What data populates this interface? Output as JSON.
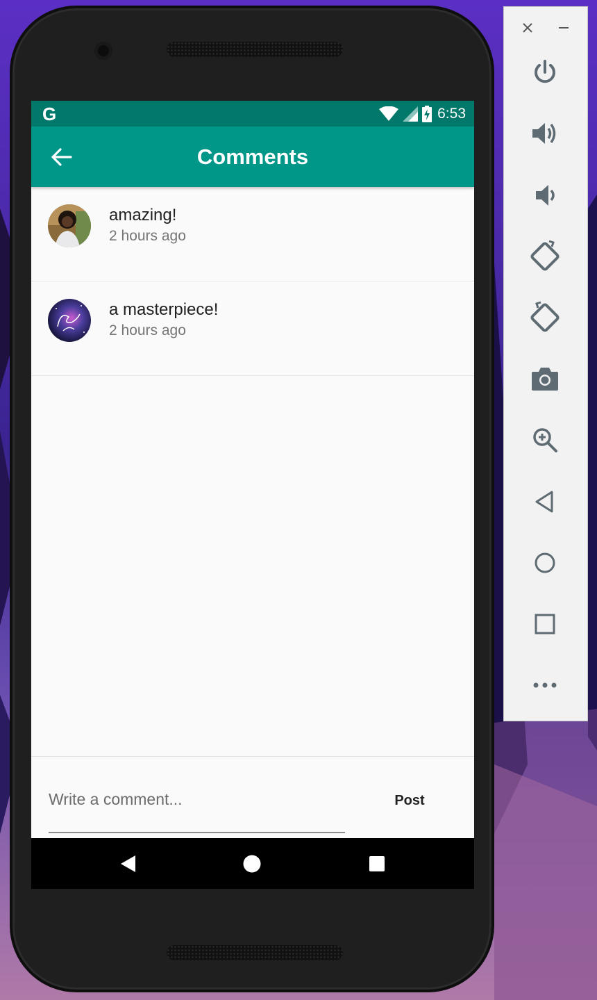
{
  "status_bar": {
    "carrier_glyph": "G",
    "time": "6:53",
    "icons": [
      "google-icon",
      "wifi-icon",
      "signal-icon",
      "battery-charging-icon"
    ]
  },
  "app_bar": {
    "title": "Comments",
    "back_icon": "arrow-back-icon"
  },
  "comments": [
    {
      "body": "amazing!",
      "time": "2 hours ago",
      "avatar_icon": "user-avatar"
    },
    {
      "body": "a masterpiece!",
      "time": "2 hours ago",
      "avatar_icon": "user-avatar"
    }
  ],
  "composer": {
    "placeholder": "Write a comment...",
    "value": "",
    "post_label": "Post"
  },
  "nav_bar": {
    "icons": [
      "nav-back-icon",
      "nav-home-icon",
      "nav-recents-icon"
    ]
  },
  "emulator_toolbar": {
    "icons": [
      "close-icon",
      "minimize-icon",
      "power-icon",
      "volume-up-icon",
      "volume-down-icon",
      "rotate-left-icon",
      "rotate-right-icon",
      "camera-icon",
      "zoom-icon",
      "back-icon",
      "home-icon",
      "overview-icon",
      "more-icon"
    ]
  },
  "colors": {
    "status_bar": "#00796b",
    "app_bar": "#009688",
    "screen_bg": "#fafafa"
  }
}
